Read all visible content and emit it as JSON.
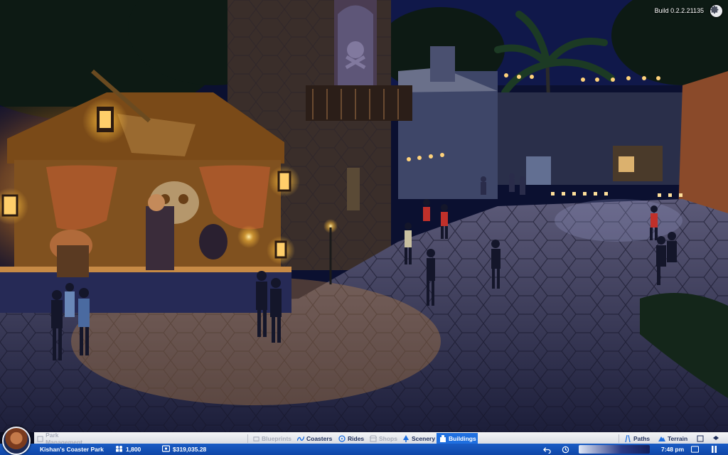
{
  "build": {
    "label": "Build 0.2.2.21135",
    "settings_icon": "gear-icon"
  },
  "toolbar": {
    "park_management": "Park Management",
    "blueprints": "Blueprints",
    "coasters": "Coasters",
    "rides": "Rides",
    "shops": "Shops",
    "scenery": "Scenery",
    "buildings": "Buildings",
    "paths": "Paths",
    "terrain": "Terrain",
    "active_tab": "Buildings"
  },
  "status": {
    "park_name": "Kishan's Coaster Park",
    "guests": "1,800",
    "money": "$319,035.28",
    "time": "7:48 pm"
  },
  "colors": {
    "toolbar_bg": "#e4e6ec",
    "status_bg": "#1552b8",
    "active_tab": "#1f6fe0",
    "lantern_glow": "#f5b73a"
  }
}
